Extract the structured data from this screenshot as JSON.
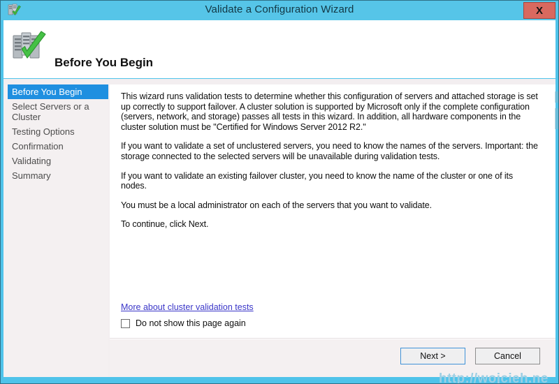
{
  "window": {
    "title": "Validate a Configuration Wizard",
    "close_label": "X",
    "titlebar_color": "#56c5e8",
    "close_color": "#d9695f"
  },
  "header": {
    "title": "Before You Begin",
    "icon": "cluster-validate-icon"
  },
  "sidebar": {
    "items": [
      {
        "label": "Before You Begin",
        "active": true
      },
      {
        "label": "Select Servers or a Cluster",
        "active": false
      },
      {
        "label": "Testing Options",
        "active": false
      },
      {
        "label": "Confirmation",
        "active": false
      },
      {
        "label": "Validating",
        "active": false
      },
      {
        "label": "Summary",
        "active": false
      }
    ],
    "active_color": "#1f8fe0"
  },
  "content": {
    "paragraphs": [
      "This wizard runs validation tests to determine whether this configuration of servers and attached storage is set up correctly to support failover. A cluster solution is supported by Microsoft only if the complete configuration (servers, network, and storage) passes all tests in this wizard. In addition, all hardware components in the cluster solution must be \"Certified for Windows Server 2012 R2.\"",
      "If you want to validate a set of unclustered servers, you need to know the names of the servers. Important: the storage connected to the selected servers will be unavailable during validation tests.",
      "If you want to validate an existing failover cluster, you need to know the name of the cluster or one of its nodes.",
      "You must be a local administrator on each of the servers that you want to validate.",
      "To continue, click Next."
    ],
    "link_label": "More about cluster validation tests",
    "link_color": "#3a36c8",
    "checkbox_label": "Do not show this page again",
    "checkbox_checked": false
  },
  "buttons": {
    "next_label": "Next >",
    "cancel_label": "Cancel"
  },
  "watermark": {
    "text": "http://wojcieh.ne"
  }
}
